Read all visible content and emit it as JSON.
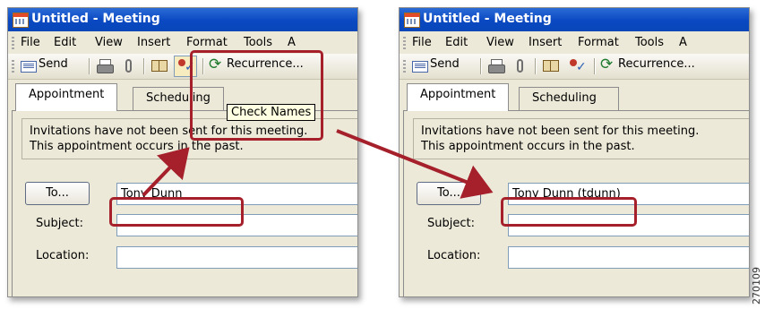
{
  "window_title": "Untitled - Meeting",
  "menu": [
    "File",
    "Edit",
    "View",
    "Insert",
    "Format",
    "Tools",
    "A"
  ],
  "toolbar": {
    "send": "Send",
    "recurrence_left": "Recurrence...",
    "recurrence_right": "Recurrence..."
  },
  "tooltip": "Check Names",
  "tabs": {
    "appointment": "Appointment",
    "scheduling_left": "Scheduling",
    "scheduling_right": "Scheduling"
  },
  "info": {
    "line1": "Invitations have not been sent for this meeting.",
    "line2": "This appointment occurs in the past."
  },
  "form": {
    "to_button": "To...",
    "subject_label": "Subject:",
    "location_label": "Location:",
    "to_value_before": "Tony Dunn",
    "to_value_after": "Tony Dunn (tdunn)",
    "subject_value": "",
    "location_value": ""
  },
  "figure_id": "270109",
  "colors": {
    "titlebar": "#0a48c2",
    "highlight": "#a5202b",
    "tooltip_bg": "#ffffe1",
    "window_bg": "#ece9d8"
  },
  "icons": [
    "calendar-icon",
    "send-icon",
    "print-icon",
    "paperclip-icon",
    "address-book-icon",
    "check-names-icon",
    "recurrence-icon"
  ]
}
